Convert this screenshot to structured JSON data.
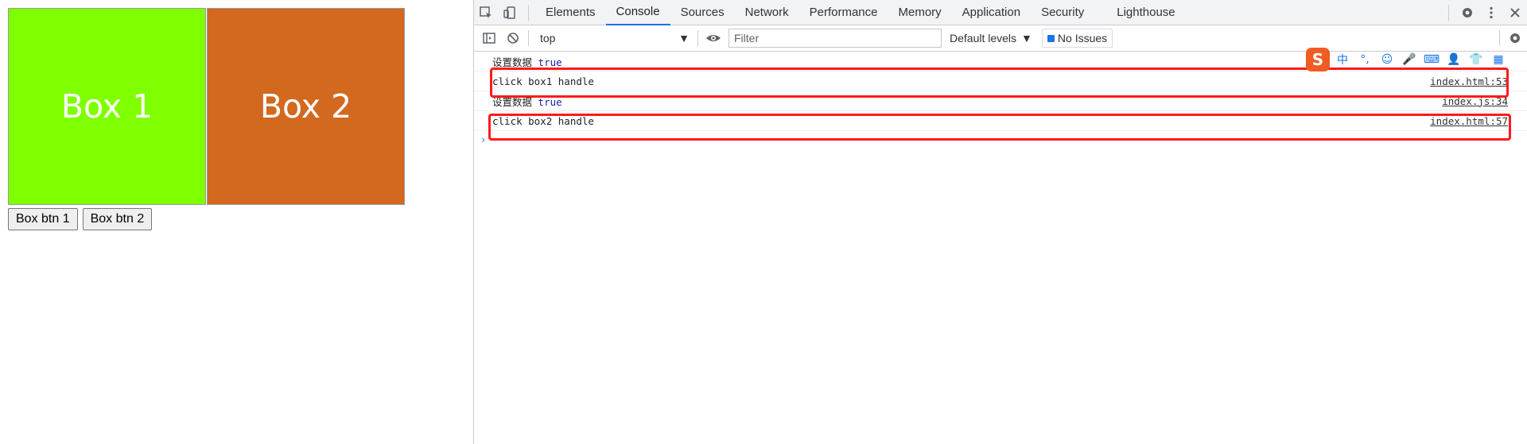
{
  "page": {
    "box1_label": "Box 1",
    "box2_label": "Box 2",
    "box1_color": "#7fff00",
    "box2_color": "#d2691e",
    "button1_label": "Box btn 1",
    "button2_label": "Box btn 2"
  },
  "devtools": {
    "tabs": [
      "Elements",
      "Console",
      "Sources",
      "Network",
      "Performance",
      "Memory",
      "Application",
      "Security",
      "Lighthouse"
    ],
    "active_tab": "Console",
    "toolbar": {
      "context": "top",
      "filter_placeholder": "Filter",
      "levels": "Default levels",
      "issues": "No Issues"
    },
    "console_rows": [
      {
        "message": "设置数据",
        "value": "true",
        "source": ""
      },
      {
        "message": "click box1 handle",
        "value": "",
        "source": "index.html:53"
      },
      {
        "message": "设置数据",
        "value": "true",
        "source": "index.js:34"
      },
      {
        "message": "click box2 handle",
        "value": "",
        "source": "index.html:57"
      }
    ],
    "prompt_symbol": "›",
    "highlight_color": "#ff1a1a"
  },
  "ime_toolbar": {
    "logo": "S",
    "items": [
      "中",
      "°,",
      "☺",
      "🎤",
      "⌨",
      "👤",
      "👕",
      "▦"
    ]
  }
}
